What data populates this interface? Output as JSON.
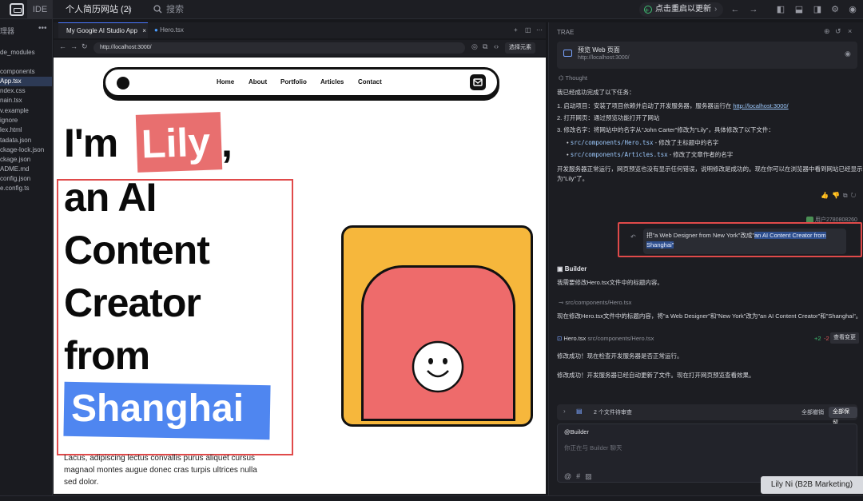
{
  "topbar": {
    "ide_label": "IDE",
    "project": "个人简历网站 (2)",
    "search_label": "搜索",
    "restart_label": "点击重启以更新"
  },
  "sidebar": {
    "title": "理器",
    "items": [
      {
        "label": "de_modules"
      },
      {
        "label": "components"
      },
      {
        "label": "App.tsx",
        "active": true
      },
      {
        "label": "ndex.css"
      },
      {
        "label": "nain.tsx"
      },
      {
        "label": "v.example"
      },
      {
        "label": "ignore"
      },
      {
        "label": "lex.html"
      },
      {
        "label": "tadata.json"
      },
      {
        "label": "ckage-lock.json"
      },
      {
        "label": "ckage.json"
      },
      {
        "label": "ADME.md"
      },
      {
        "label": "config.json"
      },
      {
        "label": "e.config.ts"
      }
    ]
  },
  "editor": {
    "tabs": [
      {
        "label": "My Google AI Studio App"
      },
      {
        "label": "Hero.tsx"
      }
    ],
    "url": "http://localhost:3000/",
    "select_element": "选择元素"
  },
  "preview": {
    "nav_links": [
      "Home",
      "About",
      "Portfolio",
      "Articles",
      "Contact"
    ],
    "hero_line1": "I'm ",
    "hero_name": "Lily",
    "hero_comma": ",",
    "hero_lines": [
      "an AI",
      "Content",
      "Creator",
      "from"
    ],
    "hero_city": "Shanghai",
    "description": "Lacus, adipiscing lectus convallis purus aliquet cursus magnaol montes augue donec cras turpis ultrices nulla sed dolor."
  },
  "chat": {
    "title": "TRAE",
    "preview_card_title": "预览 Web 页面",
    "preview_card_url": "http://localhost:3000/",
    "thought_label": "Thought",
    "summary_intro": "我已经成功完成了以下任务：",
    "step1_text": "1. 启动项目：安装了项目依赖并启动了开发服务器，服务器运行在 ",
    "step1_link": "http://localhost:3000/",
    "step2": "2. 打开网页：通过预览功能打开了网站",
    "step3": "3. 修改名字：将网站中的名字从\"John Carter\"修改为\"Lily\"，具体修改了以下文件：",
    "file1_name": "src/components/Hero.tsx",
    "file1_desc": " - 修改了主标题中的名字",
    "file2_name": "src/components/Articles.tsx",
    "file2_desc": " - 修改了文章作者的名字",
    "conclusion1": "开发服务器正常运行，网页预览也没有显示任何错误，说明修改是成功的。现在你可以在浏览器中看到网站已经显示",
    "conclusion2": "为\"Lily\"了。",
    "user_name": "用户2780808260",
    "user_msg_pre": "把\"a Web Designer from New York\"改成\"",
    "user_msg_hl1": "an AI Content Creator from",
    "user_msg_hl2": "Shanghai\"",
    "builder_label": "Builder",
    "builder_msg1": "我需要修改Hero.tsx文件中的标题内容。",
    "file_path": "src/components/Hero.tsx",
    "builder_msg2": "现在修改Hero.tsx文件中的标题内容，将\"a Web Designer\"和\"New York\"改为\"an AI Content Creator\"和\"Shanghai\"。",
    "hero_file": "Hero.tsx",
    "hero_file_path": "src/components/Hero.tsx",
    "diff_plus": "+2",
    "diff_minus": "-2",
    "view_changes": "查看变更",
    "builder_msg3": "修改成功！现在检查开发服务器是否正常运行。",
    "builder_msg4": "修改成功！开发服务器已经自动更新了文件。现在打开网页预览查看效果。",
    "pending_files": "2 个文件待审查",
    "undo_all": "全部撤销",
    "keep_all": "全部保留",
    "input_mention": "@Builder",
    "input_placeholder": "你正在与 Builder 聊天"
  },
  "tooltip": "Lily Ni (B2B Marketing)",
  "colors": {
    "accent_blue": "#4f86f0",
    "highlight_red": "#e86f6f",
    "illus_yellow": "#f6b73c",
    "annotation_red": "#e04a4a"
  }
}
